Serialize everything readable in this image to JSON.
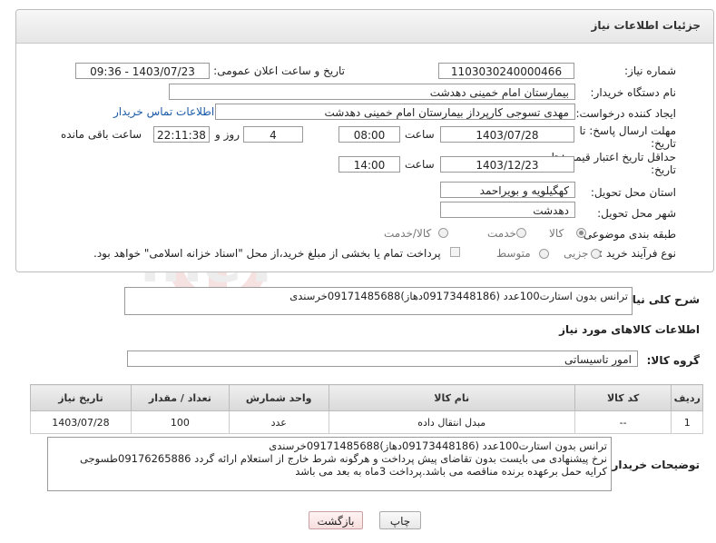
{
  "panel": {
    "title": "جزئیات اطلاعات نیاز"
  },
  "fields": {
    "need_number_label": "شماره نیاز:",
    "need_number": "1103030240000466",
    "announce_label": "تاریخ و ساعت اعلان عمومی:",
    "announce_value": "1403/07/23 - 09:36",
    "buyer_label": "نام دستگاه خریدار:",
    "buyer_value": "بیمارستان امام خمینی دهدشت",
    "creator_label": "ایجاد کننده درخواست:",
    "creator_value": "مهدی تسوجی کارپرداز بیمارستان امام خمینی دهدشت",
    "buyer_contact_link": "اطلاعات تماس خریدار",
    "deadline_label_1": "مهلت ارسال پاسخ: تا",
    "deadline_label_2": "تاریخ:",
    "deadline_date": "1403/07/28",
    "time_label": "ساعت",
    "deadline_time": "08:00",
    "days_value": "4",
    "days_label": "روز و",
    "remaining_value": "22:11:38",
    "remaining_label": "ساعت باقی مانده",
    "validity_label_1": "حداقل تاریخ اعتبار قیمت: تا",
    "validity_label_2": "تاریخ:",
    "validity_date": "1403/12/23",
    "validity_time_label": "ساعت",
    "validity_time": "14:00",
    "province_label": "استان محل تحویل:",
    "province_value": "کهگیلویه و بویراحمد",
    "city_label": "شهر محل تحویل:",
    "city_value": "دهدشت",
    "category_label": "طبقه بندی موضوعی:",
    "category_options": [
      "کالا",
      "خدمت",
      "کالا/خدمت"
    ],
    "category_selected": "کالا",
    "process_label": "نوع فرآیند خرید :",
    "process_options": [
      "جزیی",
      "متوسط"
    ],
    "payment_note": "پرداخت تمام یا بخشی از مبلغ خرید،از محل \"اسناد خزانه اسلامی\" خواهد بود."
  },
  "summary": {
    "label": "شرح کلی نیاز:",
    "value": "ترانس بدون استارت100عدد (09173448186دهاز)09171485688خرسندی"
  },
  "goods_section_title": "اطلاعات کالاهای مورد نیاز",
  "goods_group": {
    "label": "گروه کالا:",
    "value": "امور تاسیساتی"
  },
  "table": {
    "headers": [
      "ردیف",
      "کد کالا",
      "نام کالا",
      "واحد شمارش",
      "تعداد / مقدار",
      "تاریخ نیاز"
    ],
    "rows": [
      [
        "1",
        "--",
        "مبدل انتقال داده",
        "عدد",
        "100",
        "1403/07/28"
      ]
    ]
  },
  "buyer_notes": {
    "label": "توضیحات خریدار:",
    "text": "ترانس بدون استارت100عدد (09173448186دهاز)09171485688خرسندی\nنرخ پیشنهادی می بایست بدون تقاضای پیش پرداخت و هرگونه شرط خارج از استعلام ارائه گردد 09176265886طسوجی\nکرایه حمل برعهده برنده مناقصه می باشد.پرداخت 3ماه به بعد می باشد"
  },
  "buttons": {
    "print": "چاپ",
    "back": "بازگشت"
  },
  "watermark_text": "AriaTender.neT"
}
